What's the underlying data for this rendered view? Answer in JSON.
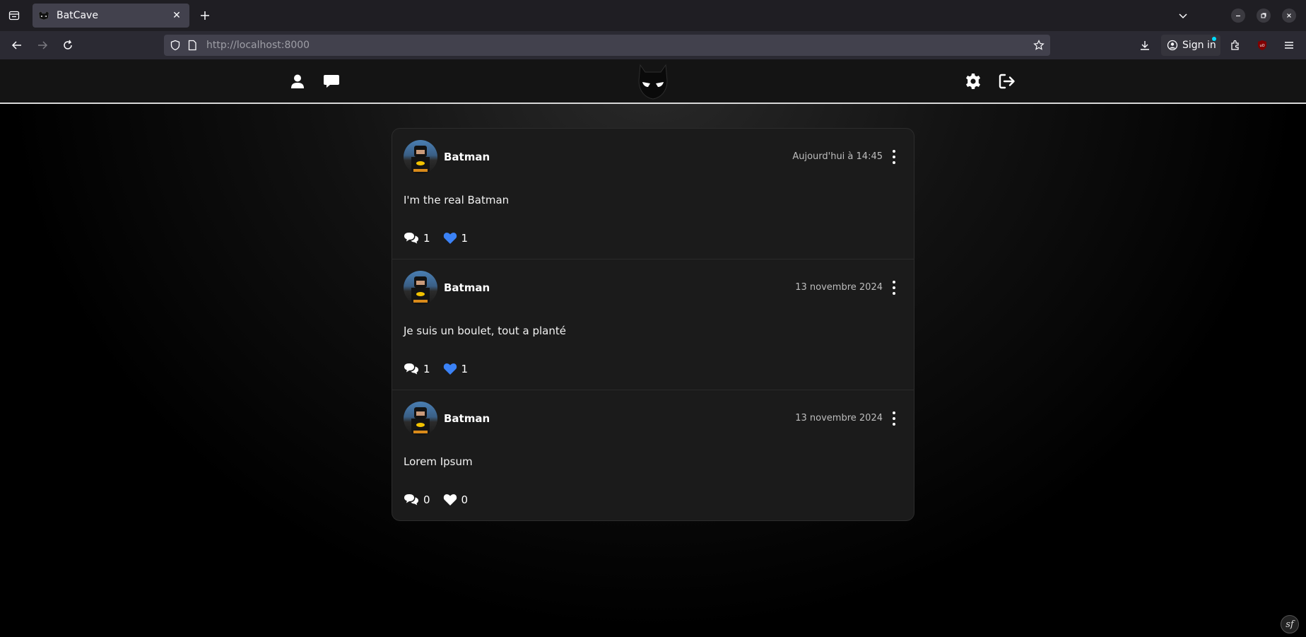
{
  "browser": {
    "tab_title": "BatCave",
    "url_host": "http://localhost",
    "url_port": ":8000",
    "signin_label": "Sign in"
  },
  "site": {
    "logo": "batman-mask-logo"
  },
  "posts": [
    {
      "author": "Batman",
      "date": "Aujourd'hui à 14:45",
      "content": "I'm the real Batman",
      "comments": "1",
      "likes": "1",
      "liked": true
    },
    {
      "author": "Batman",
      "date": "13 novembre 2024",
      "content": "Je suis un boulet, tout a planté",
      "comments": "1",
      "likes": "1",
      "liked": true
    },
    {
      "author": "Batman",
      "date": "13 novembre 2024",
      "content": "Lorem Ipsum",
      "comments": "0",
      "likes": "0",
      "liked": false
    }
  ],
  "colors": {
    "like_active": "#3b82f6",
    "like_inactive": "#ffffff",
    "header_border": "#d8d8d8",
    "card_bg": "#1b1b1b"
  },
  "badge": "sf"
}
